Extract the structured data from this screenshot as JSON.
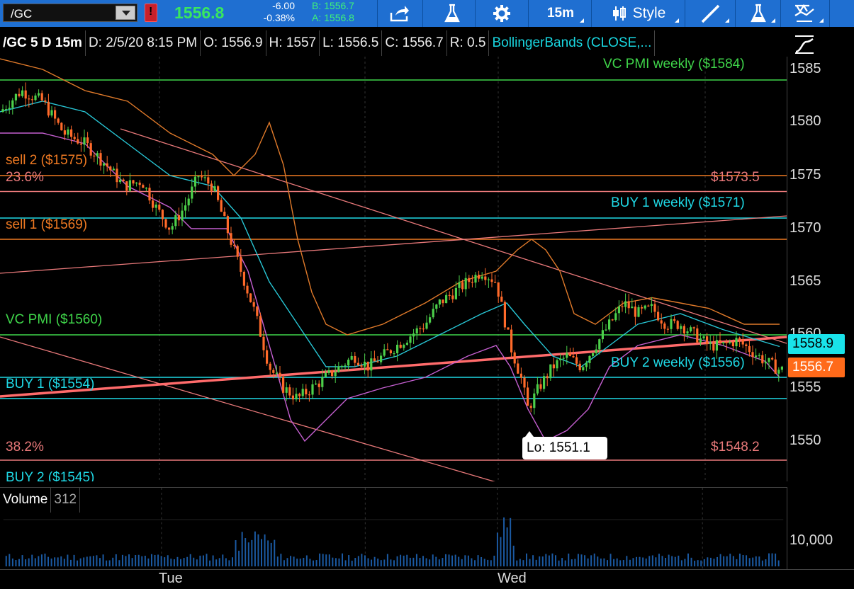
{
  "toolbar": {
    "symbol": "/GC",
    "last": "1556.8",
    "change": "-6.00",
    "change_pct": "-0.38%",
    "bid": "B: 1556.7",
    "ask": "A: 1556.8",
    "interval": "15m",
    "style_label": "Style"
  },
  "header": {
    "symbol_period": "/GC 5 D 15m",
    "date": "D: 2/5/20 8:15 PM",
    "open": "O: 1556.9",
    "high": "H: 1557",
    "low": "L: 1556.5",
    "close": "C: 1556.7",
    "range": "R: 0.5",
    "study": "BollingerBands (CLOSE,..."
  },
  "price_axis": {
    "ticks": [
      "1585",
      "1580",
      "1575",
      "1570",
      "1565",
      "1560",
      "1555",
      "1550"
    ],
    "tag_upper": "1558.9",
    "tag_last": "1556.7",
    "colors": {
      "tag_upper": "#19e3ea",
      "tag_last": "#ff6a1a"
    }
  },
  "levels": {
    "vc_pmi_weekly": "VC PMI weekly ($1584)",
    "sell2": "sell 2 ($1575)",
    "fib236": "23.6%",
    "right_1573": "$1573.5",
    "buy1_weekly": "BUY 1 weekly ($1571)",
    "sell1": "sell 1 ($1569)",
    "vc_pmi": "VC PMI ($1560)",
    "buy2_weekly": "BUY 2 weekly ($1556)",
    "buy1": "BUY 1 ($1554)",
    "fib382": "38.2%",
    "right_1548": "$1548.2",
    "buy2": "BUY 2 ($1545)"
  },
  "low_marker": "Lo: 1551.1",
  "volume": {
    "label": "Volume",
    "value": "312",
    "axis_tick": "10,000"
  },
  "time_axis": {
    "tue": "Tue",
    "wed": "Wed"
  },
  "colors": {
    "toolbar_bg": "#1f6fd1",
    "green_level": "#3fd54a",
    "orange_level": "#f07a22",
    "cyan_level": "#1fd9e6",
    "salmon_line": "#e9797a",
    "candle_up": "#4ccf4a",
    "candle_down": "#ff6a2a",
    "bb_upper": "#e07a2a",
    "bb_lower": "#c45fd0",
    "bb_mid": "#28c7d6"
  },
  "chart_data": {
    "type": "candlestick",
    "title": "/GC 5 D 15m",
    "ylim": [
      1545,
      1587
    ],
    "x_ticks": [
      "Tue",
      "Wed"
    ],
    "horizontal_levels": [
      1584,
      1575,
      1573.5,
      1571,
      1569,
      1560,
      1556,
      1554,
      1548.2,
      1545
    ],
    "close_path": [
      [
        0,
        1581
      ],
      [
        30,
        1583
      ],
      [
        60,
        1582
      ],
      [
        90,
        1579
      ],
      [
        120,
        1578
      ],
      [
        150,
        1576
      ],
      [
        175,
        1574
      ],
      [
        200,
        1574.5
      ],
      [
        220,
        1572
      ],
      [
        240,
        1570
      ],
      [
        260,
        1572
      ],
      [
        280,
        1575
      ],
      [
        300,
        1574
      ],
      [
        320,
        1570
      ],
      [
        340,
        1566
      ],
      [
        360,
        1562
      ],
      [
        380,
        1557
      ],
      [
        400,
        1555
      ],
      [
        420,
        1554
      ],
      [
        440,
        1555
      ],
      [
        460,
        1556
      ],
      [
        480,
        1557
      ],
      [
        500,
        1558
      ],
      [
        520,
        1557
      ],
      [
        540,
        1558
      ],
      [
        560,
        1559
      ],
      [
        580,
        1560
      ],
      [
        600,
        1561
      ],
      [
        620,
        1563
      ],
      [
        640,
        1564
      ],
      [
        660,
        1565
      ],
      [
        680,
        1566
      ],
      [
        700,
        1565
      ],
      [
        710,
        1562
      ],
      [
        720,
        1559
      ],
      [
        735,
        1556
      ],
      [
        745,
        1553
      ],
      [
        760,
        1555
      ],
      [
        780,
        1557
      ],
      [
        800,
        1558
      ],
      [
        820,
        1557
      ],
      [
        840,
        1559
      ],
      [
        860,
        1561
      ],
      [
        880,
        1563
      ],
      [
        900,
        1562
      ],
      [
        920,
        1562.5
      ],
      [
        940,
        1561
      ],
      [
        960,
        1561
      ],
      [
        980,
        1560
      ],
      [
        1000,
        1559
      ],
      [
        1020,
        1559
      ],
      [
        1040,
        1559.5
      ],
      [
        1060,
        1558.5
      ],
      [
        1080,
        1557.5
      ],
      [
        1100,
        1556.7
      ]
    ],
    "bb_upper": [
      [
        0,
        1586
      ],
      [
        60,
        1585
      ],
      [
        120,
        1583
      ],
      [
        180,
        1582
      ],
      [
        240,
        1579
      ],
      [
        300,
        1577
      ],
      [
        330,
        1575
      ],
      [
        360,
        1577
      ],
      [
        380,
        1580
      ],
      [
        400,
        1576
      ],
      [
        420,
        1569
      ],
      [
        440,
        1564
      ],
      [
        460,
        1561
      ],
      [
        490,
        1560
      ],
      [
        540,
        1561
      ],
      [
        600,
        1563
      ],
      [
        650,
        1565
      ],
      [
        700,
        1566
      ],
      [
        730,
        1568
      ],
      [
        750,
        1569
      ],
      [
        770,
        1568
      ],
      [
        790,
        1566
      ],
      [
        810,
        1562
      ],
      [
        840,
        1561
      ],
      [
        880,
        1563
      ],
      [
        920,
        1563.5
      ],
      [
        960,
        1563
      ],
      [
        1000,
        1562.5
      ],
      [
        1050,
        1561
      ],
      [
        1100,
        1561
      ]
    ],
    "bb_mid": [
      [
        0,
        1581
      ],
      [
        60,
        1582
      ],
      [
        120,
        1581
      ],
      [
        180,
        1578
      ],
      [
        240,
        1575
      ],
      [
        300,
        1574
      ],
      [
        340,
        1571
      ],
      [
        380,
        1565
      ],
      [
        420,
        1561
      ],
      [
        460,
        1557
      ],
      [
        500,
        1557
      ],
      [
        560,
        1558
      ],
      [
        620,
        1560
      ],
      [
        680,
        1562
      ],
      [
        715,
        1563
      ],
      [
        740,
        1561
      ],
      [
        780,
        1558
      ],
      [
        820,
        1557
      ],
      [
        860,
        1559
      ],
      [
        900,
        1561
      ],
      [
        960,
        1562
      ],
      [
        1020,
        1560.5
      ],
      [
        1100,
        1558.9
      ]
    ],
    "bb_lower": [
      [
        0,
        1579
      ],
      [
        60,
        1579
      ],
      [
        120,
        1578
      ],
      [
        180,
        1574
      ],
      [
        240,
        1572
      ],
      [
        270,
        1570
      ],
      [
        320,
        1570
      ],
      [
        350,
        1566
      ],
      [
        380,
        1559
      ],
      [
        410,
        1552
      ],
      [
        430,
        1550
      ],
      [
        460,
        1552
      ],
      [
        490,
        1554
      ],
      [
        540,
        1555
      ],
      [
        600,
        1556
      ],
      [
        660,
        1558
      ],
      [
        700,
        1559
      ],
      [
        720,
        1557
      ],
      [
        745,
        1553
      ],
      [
        770,
        1550
      ],
      [
        800,
        1551
      ],
      [
        830,
        1553
      ],
      [
        860,
        1557
      ],
      [
        900,
        1559
      ],
      [
        960,
        1560
      ],
      [
        1020,
        1559
      ],
      [
        1080,
        1557.5
      ],
      [
        1100,
        1556
      ]
    ],
    "volume_ylim": [
      0,
      12000
    ],
    "volume_axis": [
      10000
    ]
  }
}
